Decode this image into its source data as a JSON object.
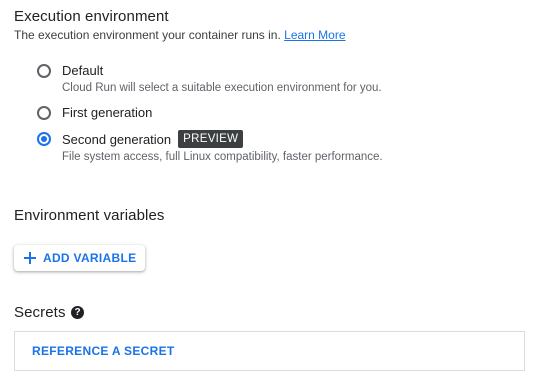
{
  "execution": {
    "title": "Execution environment",
    "description": "The execution environment your container runs in.",
    "learn_more": "Learn More",
    "options": [
      {
        "label": "Default",
        "sublabel": "Cloud Run will select a suitable execution environment for you.",
        "checked": false
      },
      {
        "label": "First generation",
        "sublabel": "",
        "checked": false
      },
      {
        "label": "Second generation",
        "badge": "PREVIEW",
        "sublabel": "File system access, full Linux compatibility, faster performance.",
        "checked": true
      }
    ]
  },
  "env_vars": {
    "title": "Environment variables",
    "add_button": "ADD VARIABLE"
  },
  "secrets": {
    "title": "Secrets",
    "help_icon": "question-circle-icon",
    "reference_button": "REFERENCE A SECRET"
  },
  "colors": {
    "accent": "#1a73e8",
    "badge_bg": "#3c4043",
    "text": "#202124",
    "muted": "#5f6368"
  }
}
